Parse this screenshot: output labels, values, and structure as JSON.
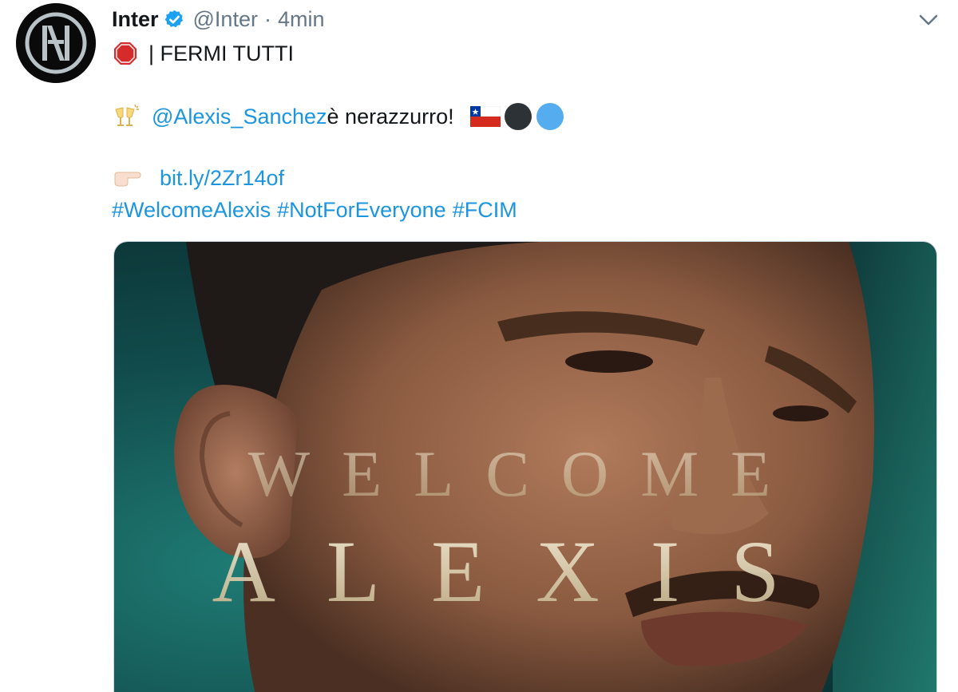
{
  "tweet": {
    "author": {
      "display_name": "Inter",
      "handle": "@Inter",
      "verified": true
    },
    "separator": "·",
    "time": "4min",
    "lines": {
      "line1_text": "| FERMI TUTTI",
      "line2_mention": "@Alexis_Sanchez",
      "line2_text": " è nerazzurro!",
      "line3_link": "bit.ly/2Zr14of",
      "hashtags": [
        "#WelcomeAlexis",
        "#NotForEveryone",
        "#FCIM"
      ]
    },
    "media": {
      "overlay_line1": "WELCOME",
      "overlay_line2": "ALEXIS"
    }
  },
  "icons": {
    "stop_sign": "stop-sign-icon",
    "cheers": "clinking-glasses-icon",
    "pointing_hand": "pointing-right-icon",
    "chile_flag": "chile-flag-icon",
    "black_circle": "black-circle-icon",
    "blue_circle": "blue-circle-icon",
    "verified": "verified-badge-icon",
    "more": "chevron-down-icon"
  },
  "colors": {
    "link": "#1b95e0",
    "secondary_text": "#657786",
    "verified": "#1da1f2"
  }
}
